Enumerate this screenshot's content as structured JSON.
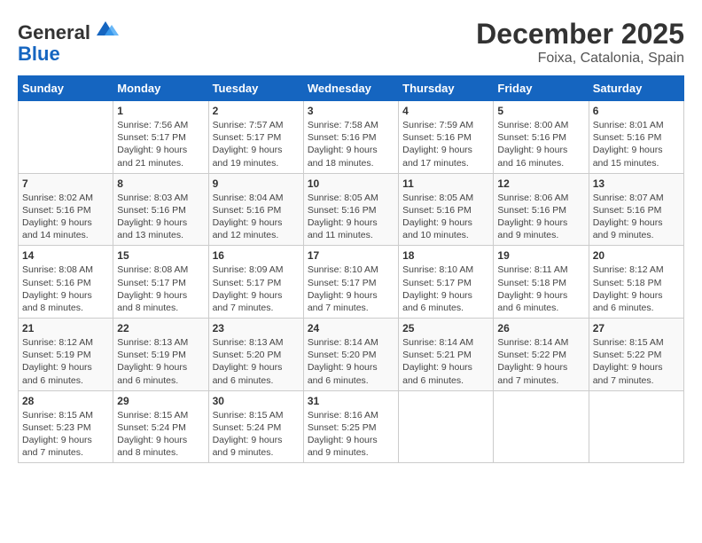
{
  "header": {
    "logo_general": "General",
    "logo_blue": "Blue",
    "month_year": "December 2025",
    "location": "Foixa, Catalonia, Spain"
  },
  "columns": [
    "Sunday",
    "Monday",
    "Tuesday",
    "Wednesday",
    "Thursday",
    "Friday",
    "Saturday"
  ],
  "weeks": [
    [
      {
        "day": "",
        "sunrise": "",
        "sunset": "",
        "daylight": ""
      },
      {
        "day": "1",
        "sunrise": "Sunrise: 7:56 AM",
        "sunset": "Sunset: 5:17 PM",
        "daylight": "Daylight: 9 hours and 21 minutes."
      },
      {
        "day": "2",
        "sunrise": "Sunrise: 7:57 AM",
        "sunset": "Sunset: 5:17 PM",
        "daylight": "Daylight: 9 hours and 19 minutes."
      },
      {
        "day": "3",
        "sunrise": "Sunrise: 7:58 AM",
        "sunset": "Sunset: 5:16 PM",
        "daylight": "Daylight: 9 hours and 18 minutes."
      },
      {
        "day": "4",
        "sunrise": "Sunrise: 7:59 AM",
        "sunset": "Sunset: 5:16 PM",
        "daylight": "Daylight: 9 hours and 17 minutes."
      },
      {
        "day": "5",
        "sunrise": "Sunrise: 8:00 AM",
        "sunset": "Sunset: 5:16 PM",
        "daylight": "Daylight: 9 hours and 16 minutes."
      },
      {
        "day": "6",
        "sunrise": "Sunrise: 8:01 AM",
        "sunset": "Sunset: 5:16 PM",
        "daylight": "Daylight: 9 hours and 15 minutes."
      }
    ],
    [
      {
        "day": "7",
        "sunrise": "Sunrise: 8:02 AM",
        "sunset": "Sunset: 5:16 PM",
        "daylight": "Daylight: 9 hours and 14 minutes."
      },
      {
        "day": "8",
        "sunrise": "Sunrise: 8:03 AM",
        "sunset": "Sunset: 5:16 PM",
        "daylight": "Daylight: 9 hours and 13 minutes."
      },
      {
        "day": "9",
        "sunrise": "Sunrise: 8:04 AM",
        "sunset": "Sunset: 5:16 PM",
        "daylight": "Daylight: 9 hours and 12 minutes."
      },
      {
        "day": "10",
        "sunrise": "Sunrise: 8:05 AM",
        "sunset": "Sunset: 5:16 PM",
        "daylight": "Daylight: 9 hours and 11 minutes."
      },
      {
        "day": "11",
        "sunrise": "Sunrise: 8:05 AM",
        "sunset": "Sunset: 5:16 PM",
        "daylight": "Daylight: 9 hours and 10 minutes."
      },
      {
        "day": "12",
        "sunrise": "Sunrise: 8:06 AM",
        "sunset": "Sunset: 5:16 PM",
        "daylight": "Daylight: 9 hours and 9 minutes."
      },
      {
        "day": "13",
        "sunrise": "Sunrise: 8:07 AM",
        "sunset": "Sunset: 5:16 PM",
        "daylight": "Daylight: 9 hours and 9 minutes."
      }
    ],
    [
      {
        "day": "14",
        "sunrise": "Sunrise: 8:08 AM",
        "sunset": "Sunset: 5:16 PM",
        "daylight": "Daylight: 9 hours and 8 minutes."
      },
      {
        "day": "15",
        "sunrise": "Sunrise: 8:08 AM",
        "sunset": "Sunset: 5:17 PM",
        "daylight": "Daylight: 9 hours and 8 minutes."
      },
      {
        "day": "16",
        "sunrise": "Sunrise: 8:09 AM",
        "sunset": "Sunset: 5:17 PM",
        "daylight": "Daylight: 9 hours and 7 minutes."
      },
      {
        "day": "17",
        "sunrise": "Sunrise: 8:10 AM",
        "sunset": "Sunset: 5:17 PM",
        "daylight": "Daylight: 9 hours and 7 minutes."
      },
      {
        "day": "18",
        "sunrise": "Sunrise: 8:10 AM",
        "sunset": "Sunset: 5:17 PM",
        "daylight": "Daylight: 9 hours and 6 minutes."
      },
      {
        "day": "19",
        "sunrise": "Sunrise: 8:11 AM",
        "sunset": "Sunset: 5:18 PM",
        "daylight": "Daylight: 9 hours and 6 minutes."
      },
      {
        "day": "20",
        "sunrise": "Sunrise: 8:12 AM",
        "sunset": "Sunset: 5:18 PM",
        "daylight": "Daylight: 9 hours and 6 minutes."
      }
    ],
    [
      {
        "day": "21",
        "sunrise": "Sunrise: 8:12 AM",
        "sunset": "Sunset: 5:19 PM",
        "daylight": "Daylight: 9 hours and 6 minutes."
      },
      {
        "day": "22",
        "sunrise": "Sunrise: 8:13 AM",
        "sunset": "Sunset: 5:19 PM",
        "daylight": "Daylight: 9 hours and 6 minutes."
      },
      {
        "day": "23",
        "sunrise": "Sunrise: 8:13 AM",
        "sunset": "Sunset: 5:20 PM",
        "daylight": "Daylight: 9 hours and 6 minutes."
      },
      {
        "day": "24",
        "sunrise": "Sunrise: 8:14 AM",
        "sunset": "Sunset: 5:20 PM",
        "daylight": "Daylight: 9 hours and 6 minutes."
      },
      {
        "day": "25",
        "sunrise": "Sunrise: 8:14 AM",
        "sunset": "Sunset: 5:21 PM",
        "daylight": "Daylight: 9 hours and 6 minutes."
      },
      {
        "day": "26",
        "sunrise": "Sunrise: 8:14 AM",
        "sunset": "Sunset: 5:22 PM",
        "daylight": "Daylight: 9 hours and 7 minutes."
      },
      {
        "day": "27",
        "sunrise": "Sunrise: 8:15 AM",
        "sunset": "Sunset: 5:22 PM",
        "daylight": "Daylight: 9 hours and 7 minutes."
      }
    ],
    [
      {
        "day": "28",
        "sunrise": "Sunrise: 8:15 AM",
        "sunset": "Sunset: 5:23 PM",
        "daylight": "Daylight: 9 hours and 7 minutes."
      },
      {
        "day": "29",
        "sunrise": "Sunrise: 8:15 AM",
        "sunset": "Sunset: 5:24 PM",
        "daylight": "Daylight: 9 hours and 8 minutes."
      },
      {
        "day": "30",
        "sunrise": "Sunrise: 8:15 AM",
        "sunset": "Sunset: 5:24 PM",
        "daylight": "Daylight: 9 hours and 9 minutes."
      },
      {
        "day": "31",
        "sunrise": "Sunrise: 8:16 AM",
        "sunset": "Sunset: 5:25 PM",
        "daylight": "Daylight: 9 hours and 9 minutes."
      },
      {
        "day": "",
        "sunrise": "",
        "sunset": "",
        "daylight": ""
      },
      {
        "day": "",
        "sunrise": "",
        "sunset": "",
        "daylight": ""
      },
      {
        "day": "",
        "sunrise": "",
        "sunset": "",
        "daylight": ""
      }
    ]
  ]
}
